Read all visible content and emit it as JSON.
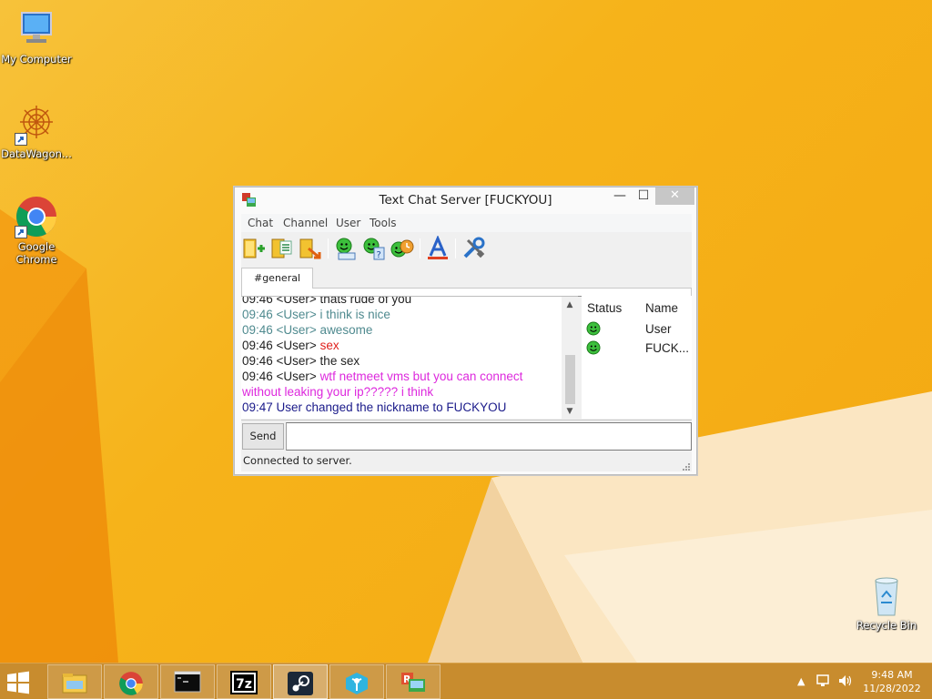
{
  "desktop": {
    "icons": [
      {
        "label": "My Computer",
        "icon": "computer-icon"
      },
      {
        "label": "DataWagon...",
        "icon": "datawagon-icon"
      },
      {
        "label": "Google Chrome",
        "icon": "chrome-icon"
      },
      {
        "label": "Recycle Bin",
        "icon": "recycle-bin-icon"
      }
    ]
  },
  "window": {
    "title": "Text Chat Server [FUCKYOU]",
    "controls": {
      "minimize": "—",
      "maximize": "☐",
      "close": "✕"
    },
    "menu": [
      "Chat",
      "Channel",
      "User",
      "Tools"
    ],
    "toolbar": [
      "join-channel-icon",
      "channel-list-icon",
      "leave-channel-icon",
      "user-info-icon",
      "whois-icon",
      "away-icon",
      "font-icon",
      "settings-icon"
    ],
    "tab": "#general",
    "log": [
      {
        "text": "09:46 <User> thats rude of you",
        "color": "#222222"
      },
      {
        "text": "09:46 <User> i think is nice",
        "color": "#4f8a8f"
      },
      {
        "text": "09:46 <User> awesome",
        "color": "#4f8a8f"
      },
      {
        "prefix": "09:46 <User> ",
        "text": "sex",
        "color": "#e0201c"
      },
      {
        "text": "09:46 <User> the sex",
        "color": "#222222"
      },
      {
        "prefix": "09:46 <User> ",
        "text": "wtf netmeet vms but you can connect without leaking your ip????? i think",
        "color": "#dd28dd"
      },
      {
        "text": "09:47 User changed the nickname to FUCKYOU",
        "color": "#1a1a8a"
      }
    ],
    "userlist": {
      "headers": [
        "Status",
        "Name"
      ],
      "users": [
        {
          "name": "User",
          "status": "online"
        },
        {
          "name": "FUCK...",
          "status": "online"
        }
      ]
    },
    "send_label": "Send",
    "input_value": "",
    "status": "Connected to server."
  },
  "taskbar": {
    "apps": [
      "file-explorer-icon",
      "chrome-icon",
      "terminal-icon",
      "7zip-icon",
      "steam-icon",
      "vpn-icon",
      "remote-app-icon"
    ],
    "time": "9:48 AM",
    "date": "11/28/2022"
  }
}
